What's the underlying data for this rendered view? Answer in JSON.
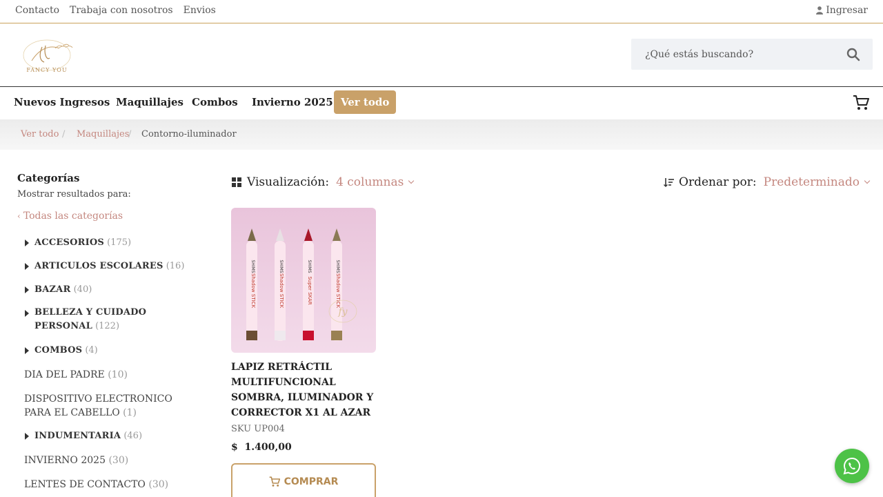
{
  "topbar": {
    "links": [
      "Contacto",
      "Trabaja con nosotros",
      "Envios"
    ],
    "login": "Ingresar",
    "login_icon": "user-icon"
  },
  "header": {
    "logo_text": "FANCY YOU",
    "logo_monogram": "fy",
    "search_placeholder": "¿Qué estás buscando?",
    "search_icon": "search-icon"
  },
  "nav": {
    "items": [
      "Nuevos Ingresos",
      "Maquillajes",
      "Combos",
      "Invierno 2025"
    ],
    "view_all": "Ver todo",
    "cart_icon": "cart-icon"
  },
  "breadcrumb": {
    "items": [
      "Ver todo",
      "Maquillajes",
      "Contorno-iluminador"
    ],
    "separator": "/"
  },
  "sidebar": {
    "title": "Categorías",
    "subtitle": "Mostrar resultados para:",
    "all_categories": "Todas las categorías",
    "categories": [
      {
        "name": "ACCESORIOS",
        "count": "(175)",
        "expandable": true
      },
      {
        "name": "ARTICULOS ESCOLARES",
        "count": "(16)",
        "expandable": true
      },
      {
        "name": "BAZAR",
        "count": "(40)",
        "expandable": true
      },
      {
        "name": "BELLEZA Y CUIDADO PERSONAL",
        "count": "(122)",
        "expandable": true
      },
      {
        "name": "COMBOS",
        "count": "(4)",
        "expandable": true
      },
      {
        "name": "DIA DEL PADRE",
        "count": "(10)",
        "expandable": false
      },
      {
        "name": "DISPOSITIVO ELECTRONICO PARA EL CABELLO",
        "count": "(1)",
        "expandable": false
      },
      {
        "name": "INDUMENTARIA",
        "count": "(46)",
        "expandable": true
      },
      {
        "name": "INVIERNO 2025",
        "count": "(30)",
        "expandable": false
      },
      {
        "name": "LENTES DE CONTACTO",
        "count": "(30)",
        "expandable": false
      }
    ]
  },
  "toolbar": {
    "view_label": "Visualización:",
    "view_value": "4 columnas",
    "sort_label": "Ordenar por:",
    "sort_value": "Predeterminado"
  },
  "product": {
    "name": "LAPIZ RETRÁCTIL MULTIFUNCIONAL SOMBRA, ILUMINADOR Y CORRECTOR X1 AL AZAR",
    "sku": "SKU UP004",
    "currency": "$",
    "price": "1.400,00",
    "buy_label": "COMPRAR",
    "pencil_brand": "SHIMS",
    "pencil_labels": [
      "Shadow STICK",
      "Shadow STICK",
      "Super SKAR",
      "Shadow STICK"
    ]
  },
  "colors": {
    "accent": "#c9a169",
    "link": "#c4877f",
    "whatsapp": "#4dc247"
  }
}
